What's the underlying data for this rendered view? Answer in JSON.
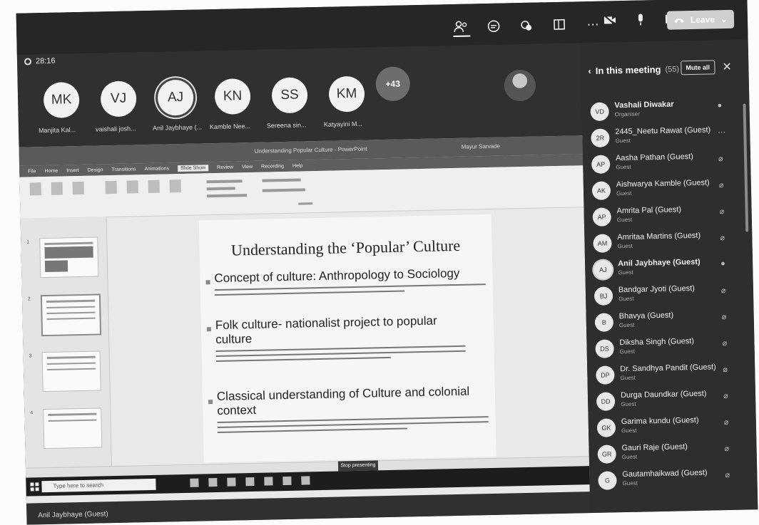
{
  "meeting": {
    "timer": "28:16",
    "leave_label": "Leave",
    "bottom_user": "Anil Jaybhaye (Guest)"
  },
  "participants_row": [
    {
      "initials": "MK",
      "name": "Manjita Kal..."
    },
    {
      "initials": "VJ",
      "name": "vaishali josh..."
    },
    {
      "initials": "AJ",
      "name": "Anil Jaybhaye (..."
    },
    {
      "initials": "KN",
      "name": "Kamble Nee..."
    },
    {
      "initials": "SS",
      "name": "Sereena sin..."
    },
    {
      "initials": "KM",
      "name": "Katyayini M..."
    }
  ],
  "more_count": "+43",
  "shared_screen": {
    "window_title": "Understanding Popular Culture - PowerPoint",
    "user": "Mayur Sarvade",
    "tabs": [
      "File",
      "Home",
      "Insert",
      "Design",
      "Transitions",
      "Animations",
      "Slide Show",
      "Review",
      "View",
      "Recording",
      "Help"
    ],
    "slide": {
      "title": "Understanding the ‘Popular’ Culture",
      "bullets": [
        "Concept of culture: Anthropology to Sociology",
        "Folk culture- nationalist project to popular culture",
        "Classical understanding of Culture and colonial context"
      ]
    },
    "stop_presenting": "Stop presenting",
    "search_placeholder": "Type here to search"
  },
  "panel": {
    "title": "In this meeting",
    "count": "(55)",
    "mute_all": "Mute all",
    "participants": [
      {
        "initials": "VD",
        "name": "Vashali Diwakar",
        "role": "Organiser",
        "mic": "on"
      },
      {
        "initials": "2R",
        "name": "2445_Neetu Rawat (Guest)",
        "role": "Guest",
        "mic": "more"
      },
      {
        "initials": "AP",
        "name": "Aasha Pathan (Guest)",
        "role": "Guest",
        "mic": "muted"
      },
      {
        "initials": "AK",
        "name": "Aishwarya Kamble (Guest)",
        "role": "Guest",
        "mic": "muted"
      },
      {
        "initials": "AP",
        "name": "Amrita Pal (Guest)",
        "role": "Guest",
        "mic": "muted"
      },
      {
        "initials": "AM",
        "name": "Amritaa Martins (Guest)",
        "role": "Guest",
        "mic": "muted"
      },
      {
        "initials": "AJ",
        "name": "Anil Jaybhaye (Guest)",
        "role": "Guest",
        "mic": "on"
      },
      {
        "initials": "BJ",
        "name": "Bandgar Jyoti (Guest)",
        "role": "Guest",
        "mic": "muted"
      },
      {
        "initials": "B",
        "name": "Bhavya (Guest)",
        "role": "Guest",
        "mic": "muted"
      },
      {
        "initials": "DS",
        "name": "Diksha Singh (Guest)",
        "role": "Guest",
        "mic": "muted"
      },
      {
        "initials": "DP",
        "name": "Dr. Sandhya Pandit (Guest)",
        "role": "Guest",
        "mic": "muted"
      },
      {
        "initials": "DD",
        "name": "Durga Daundkar (Guest)",
        "role": "Guest",
        "mic": "muted"
      },
      {
        "initials": "GK",
        "name": "Garima kundu (Guest)",
        "role": "Guest",
        "mic": "muted"
      },
      {
        "initials": "GR",
        "name": "Gauri Raje (Guest)",
        "role": "Guest",
        "mic": "muted"
      },
      {
        "initials": "G",
        "name": "Gautamhaikwad (Guest)",
        "role": "Guest",
        "mic": "muted"
      }
    ]
  }
}
